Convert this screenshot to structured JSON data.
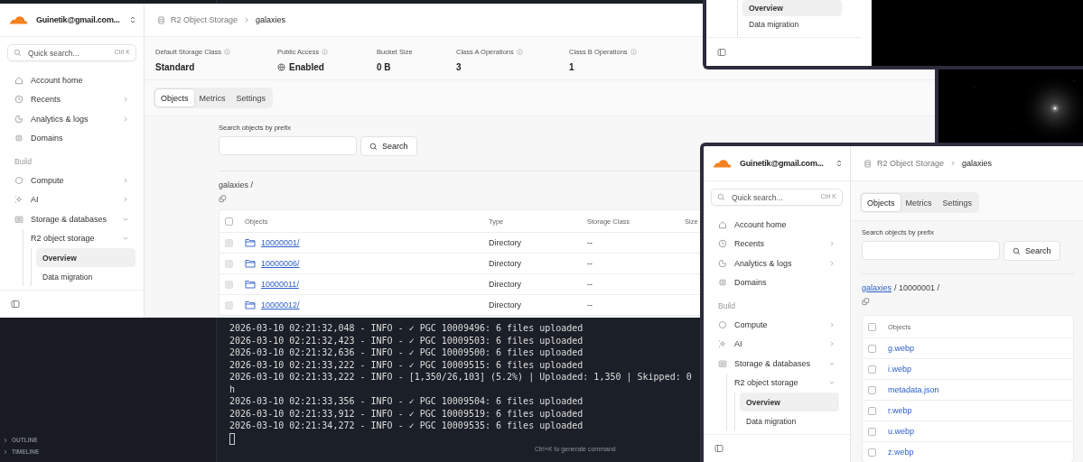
{
  "editor": {
    "panels": [
      {
        "label": "OUTLINE",
        "expanded": false
      },
      {
        "label": "TIMELINE",
        "expanded": false
      }
    ],
    "terminal_lines": [
      "2026-03-10 02:21:32,048 - INFO - ✓ PGC 10009496: 6 files uploaded",
      "2026-03-10 02:21:32,423 - INFO - ✓ PGC 10009503: 6 files uploaded",
      "2026-03-10 02:21:32,636 - INFO - ✓ PGC 10009500: 6 files uploaded",
      "2026-03-10 02:21:33,222 - INFO - ✓ PGC 10009515: 6 files uploaded",
      "2026-03-10 02:21:33,222 - INFO - [1,350/26,103] (5.2%) | Uploaded: 1,350 | Skipped: 0",
      "h",
      "2026-03-10 02:21:33,356 - INFO - ✓ PGC 10009504: 6 files uploaded",
      "2026-03-10 02:21:33,912 - INFO - ✓ PGC 10009519: 6 files uploaded",
      "2026-03-10 02:21:34,272 - INFO - ✓ PGC 10009535: 6 files uploaded"
    ],
    "hint": "Ctrl+K to generate command"
  },
  "dashboards": [
    {
      "account": "Guinetik@gmail.com...",
      "search": {
        "placeholder": "Quick search...",
        "shortcut": "Ctrl K"
      },
      "nav": [
        {
          "kind": "item",
          "label": "Account home"
        },
        {
          "kind": "item",
          "label": "Recents",
          "expanded": false
        },
        {
          "kind": "item",
          "label": "Analytics & logs",
          "expanded": false
        },
        {
          "kind": "item",
          "label": "Domains"
        },
        {
          "kind": "heading",
          "label": "Build"
        },
        {
          "kind": "item",
          "label": "Compute",
          "expanded": false
        },
        {
          "kind": "item",
          "label": "AI",
          "expanded": false
        },
        {
          "kind": "item",
          "label": "Storage & databases",
          "expanded": true,
          "children": [
            {
              "label": "R2 object storage",
              "expanded": true,
              "children": [
                {
                  "label": "Overview",
                  "selected": true
                },
                {
                  "label": "Data migration",
                  "selected": false
                }
              ]
            }
          ]
        }
      ],
      "breadcrumb": [
        "R2 Object Storage",
        "galaxies"
      ],
      "stats": [
        {
          "label": "Default Storage Class",
          "value": "Standard",
          "info": true,
          "kind": "text"
        },
        {
          "label": "Public Access",
          "value": "Enabled",
          "info": true,
          "kind": "status"
        },
        {
          "label": "Bucket Size",
          "value": "0 B",
          "info": false,
          "kind": "text"
        },
        {
          "label": "Class A Operations",
          "value": "3",
          "info": true,
          "kind": "text"
        },
        {
          "label": "Class B Operations",
          "value": "1",
          "info": true,
          "kind": "text"
        }
      ],
      "tabs": [
        {
          "label": "Objects",
          "selected": true
        },
        {
          "label": "Metrics",
          "selected": false
        },
        {
          "label": "Settings",
          "selected": false
        }
      ],
      "prefix_label": "Search objects by prefix",
      "search_button": "Search",
      "path": [
        {
          "text": "galaxies /",
          "link": false
        }
      ],
      "select_all_checked": false,
      "columns": [
        "Objects",
        "Type",
        "Storage Class",
        "Size"
      ],
      "rows": [
        {
          "kind": "folder",
          "checked": false,
          "disabled": true,
          "cells": [
            "10000001/",
            "Directory",
            "--"
          ]
        },
        {
          "kind": "folder",
          "checked": false,
          "disabled": true,
          "cells": [
            "10000006/",
            "Directory",
            "--"
          ]
        },
        {
          "kind": "folder",
          "checked": false,
          "disabled": true,
          "cells": [
            "10000011/",
            "Directory",
            "--"
          ]
        },
        {
          "kind": "folder",
          "checked": false,
          "disabled": true,
          "cells": [
            "10000012/",
            "Directory",
            "--"
          ]
        }
      ]
    },
    {
      "account": "Guinetik@gmail.com...",
      "search": {
        "placeholder": "Quick search...",
        "shortcut": "Ctrl K"
      },
      "nav": [
        {
          "kind": "item",
          "label": "Account home"
        },
        {
          "kind": "item",
          "label": "Recents",
          "expanded": false
        },
        {
          "kind": "item",
          "label": "Analytics & logs",
          "expanded": false
        },
        {
          "kind": "item",
          "label": "Domains"
        },
        {
          "kind": "heading",
          "label": "Build"
        },
        {
          "kind": "item",
          "label": "Compute",
          "expanded": false
        },
        {
          "kind": "item",
          "label": "AI",
          "expanded": false
        },
        {
          "kind": "item",
          "label": "Storage & databases",
          "expanded": true,
          "children": [
            {
              "label": "R2 object storage",
              "expanded": true,
              "children": [
                {
                  "label": "Overview",
                  "selected": true
                },
                {
                  "label": "Data migration",
                  "selected": false
                }
              ]
            }
          ]
        }
      ],
      "breadcrumb": [
        "R2 Object Storage",
        "galaxies"
      ],
      "tabs": [
        {
          "label": "Objects",
          "selected": true
        },
        {
          "label": "Metrics",
          "selected": false
        },
        {
          "label": "Settings",
          "selected": false
        }
      ],
      "prefix_label": "Search objects by prefix",
      "search_button": "Search",
      "path": [
        {
          "text": "galaxies",
          "link": true
        },
        {
          "text": "/ 10000001 /",
          "link": false
        }
      ],
      "select_all_checked": false,
      "columns": [
        "Objects"
      ],
      "rows": [
        {
          "kind": "file",
          "checked": false,
          "disabled": false,
          "cells": [
            "g.webp"
          ]
        },
        {
          "kind": "file",
          "checked": false,
          "disabled": false,
          "cells": [
            "i.webp"
          ]
        },
        {
          "kind": "file",
          "checked": false,
          "disabled": false,
          "cells": [
            "metadata.json"
          ]
        },
        {
          "kind": "file",
          "checked": false,
          "disabled": false,
          "cells": [
            "r.webp"
          ]
        },
        {
          "kind": "file",
          "checked": false,
          "disabled": false,
          "cells": [
            "u.webp"
          ]
        },
        {
          "kind": "file",
          "checked": false,
          "disabled": false,
          "cells": [
            "z.webp"
          ]
        }
      ]
    }
  ],
  "back_window": {
    "nav": [
      {
        "label": "Overview",
        "selected": true
      },
      {
        "label": "Data migration",
        "selected": false
      }
    ]
  }
}
